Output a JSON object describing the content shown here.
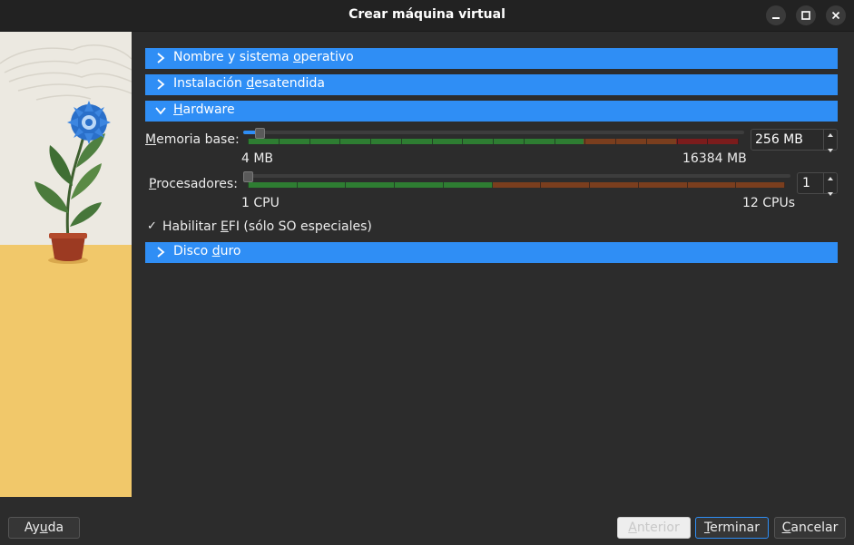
{
  "window": {
    "title": "Crear máquina virtual"
  },
  "window_buttons": {
    "minimize": "–",
    "maximize": "□",
    "close": "×"
  },
  "sections": {
    "name_os": {
      "label_pre": "Nombre y sistema ",
      "label_u": "o",
      "label_post": "perativo",
      "expanded": false
    },
    "unattended": {
      "label_pre": "Instalación ",
      "label_u": "d",
      "label_post": "esatendida",
      "expanded": false
    },
    "hardware": {
      "label_u": "H",
      "label_post": "ardware",
      "expanded": true
    },
    "disk": {
      "label_pre": "Disco ",
      "label_u": "d",
      "label_post": "uro",
      "expanded": false
    }
  },
  "memory": {
    "label_u": "M",
    "label_post": "emoria base:",
    "value": "256 MB",
    "min_label": "4 MB",
    "max_label": "16384 MB",
    "fraction": 0.0154
  },
  "processors": {
    "label_u": "P",
    "label_post": "rocesadores:",
    "value": "1",
    "min_label": "1 CPU",
    "max_label": "12 CPUs",
    "fraction": 0.0
  },
  "efi": {
    "check": "✓",
    "label_pre": "Habilitar ",
    "label_u": "E",
    "label_post": "FI (sólo SO especiales)",
    "checked": true
  },
  "buttons": {
    "help": {
      "label_pre": "Ay",
      "label_u": "u",
      "label_post": "da"
    },
    "back": {
      "label_u": "A",
      "label_post": "nterior",
      "enabled": false
    },
    "finish": {
      "label_u": "T",
      "label_post": "erminar"
    },
    "cancel": {
      "label_u": "C",
      "label_post": "ancelar"
    }
  },
  "colors": {
    "accent": "#2f8ef5",
    "slider_ok": "#2e7d32",
    "slider_warn": "#7a3e1e",
    "slider_bad": "#7b1c1c"
  }
}
